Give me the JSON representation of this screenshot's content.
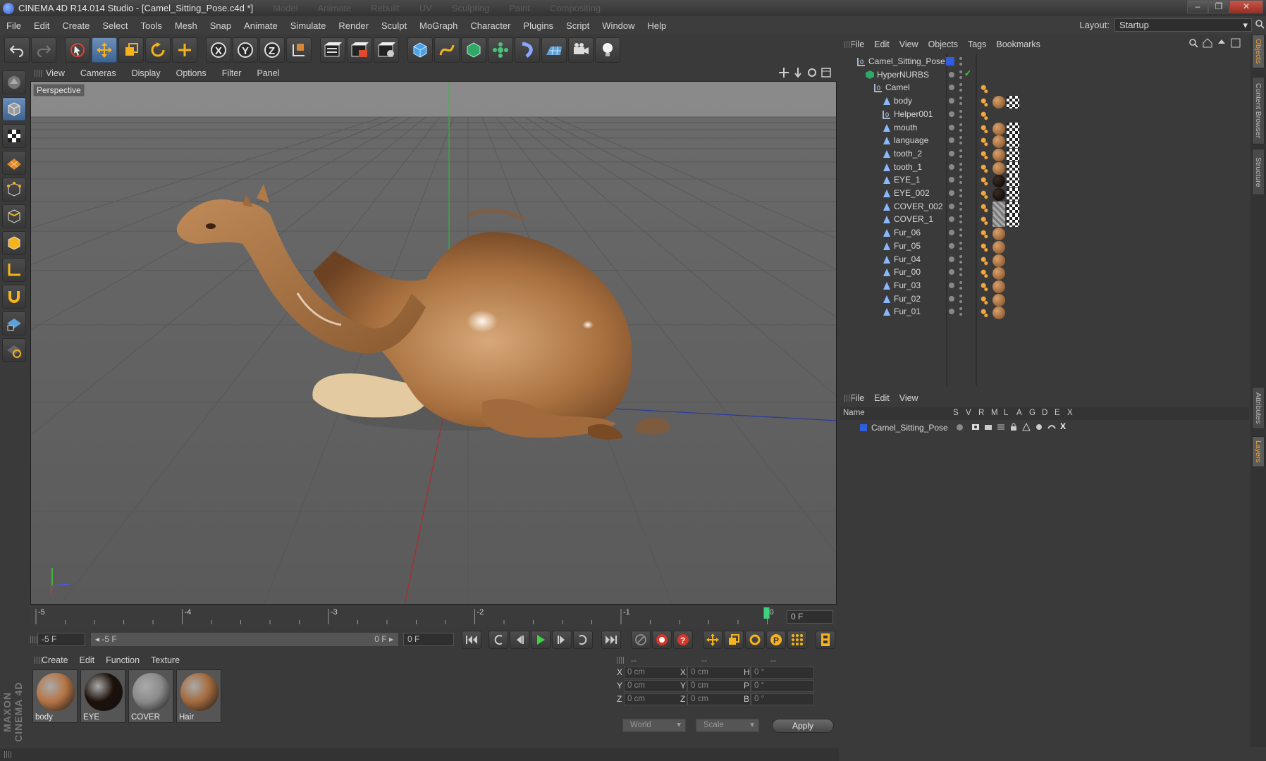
{
  "window": {
    "title": "CINEMA 4D R14.014 Studio - [Camel_Sitting_Pose.c4d *]",
    "ghost_tabs": [
      "Model",
      "Animate",
      "Rebuilt",
      "UV",
      "Sculpting",
      "Paint",
      "Compositing"
    ],
    "buttons": {
      "min": "–",
      "max": "❐",
      "close": "✕"
    }
  },
  "menu": {
    "items": [
      "File",
      "Edit",
      "Create",
      "Select",
      "Tools",
      "Mesh",
      "Snap",
      "Animate",
      "Simulate",
      "Render",
      "Sculpt",
      "MoGraph",
      "Character",
      "Plugins",
      "Script",
      "Window",
      "Help"
    ],
    "layout_label": "Layout:",
    "layout_value": "Startup"
  },
  "viewport": {
    "menu": [
      "View",
      "Cameras",
      "Display",
      "Options",
      "Filter",
      "Panel"
    ],
    "label": "Perspective"
  },
  "timeline": {
    "ticks": [
      "-5",
      "-4",
      "-3",
      "-2",
      "-1",
      "0"
    ],
    "current": "0 F"
  },
  "controls": {
    "start": "-5 F",
    "range_start": "-5 F",
    "range_end": "0 F",
    "end": "0 F"
  },
  "materials": {
    "menu": [
      "Create",
      "Edit",
      "Function",
      "Texture"
    ],
    "items": [
      {
        "name": "body",
        "color": "#b57445"
      },
      {
        "name": "EYE",
        "color": "#1c110a"
      },
      {
        "name": "COVER",
        "color": "#8a8a8a"
      },
      {
        "name": "Hair",
        "color": "#a36a3d"
      }
    ]
  },
  "coords": {
    "headers": [
      "--",
      "--",
      "--"
    ],
    "rows": [
      {
        "l1": "X",
        "v1": "0 cm",
        "l2": "X",
        "v2": "0 cm",
        "l3": "H",
        "v3": "0 °"
      },
      {
        "l1": "Y",
        "v1": "0 cm",
        "l2": "Y",
        "v2": "0 cm",
        "l3": "P",
        "v3": "0 °"
      },
      {
        "l1": "Z",
        "v1": "0 cm",
        "l2": "Z",
        "v2": "0 cm",
        "l3": "B",
        "v3": "0 °"
      }
    ],
    "world": "World",
    "scale": "Scale",
    "apply": "Apply"
  },
  "objects": {
    "menu": [
      "File",
      "Edit",
      "View",
      "Objects",
      "Tags",
      "Bookmarks"
    ],
    "items": [
      {
        "name": "Camel_Sitting_Pose",
        "tags": []
      },
      {
        "name": "HyperNURBS",
        "tags": []
      },
      {
        "name": "Camel",
        "tags": [
          "phong"
        ]
      },
      {
        "name": "body",
        "tags": [
          "phong",
          "matc",
          "uv"
        ]
      },
      {
        "name": "Helper001",
        "tags": [
          "phong"
        ]
      },
      {
        "name": "mouth",
        "tags": [
          "phong",
          "matc",
          "uv"
        ]
      },
      {
        "name": "language",
        "tags": [
          "phong",
          "matc",
          "uv"
        ]
      },
      {
        "name": "tooth_2",
        "tags": [
          "phong",
          "matc",
          "uv"
        ]
      },
      {
        "name": "tooth_1",
        "tags": [
          "phong",
          "matc",
          "uv"
        ]
      },
      {
        "name": "EYE_1",
        "tags": [
          "phong",
          "eye",
          "uv"
        ]
      },
      {
        "name": "EYE_002",
        "tags": [
          "phong",
          "eye",
          "uv"
        ]
      },
      {
        "name": "COVER_002",
        "tags": [
          "phong",
          "cover",
          "uv"
        ]
      },
      {
        "name": "COVER_1",
        "tags": [
          "phong",
          "cover",
          "uv"
        ]
      },
      {
        "name": "Fur_06",
        "tags": [
          "phong",
          "matc"
        ]
      },
      {
        "name": "Fur_05",
        "tags": [
          "phong",
          "matc"
        ]
      },
      {
        "name": "Fur_04",
        "tags": [
          "phong",
          "matc"
        ]
      },
      {
        "name": "Fur_00",
        "tags": [
          "phong",
          "matc"
        ]
      },
      {
        "name": "Fur_03",
        "tags": [
          "phong",
          "matc"
        ]
      },
      {
        "name": "Fur_02",
        "tags": [
          "phong",
          "matc"
        ]
      },
      {
        "name": "Fur_01",
        "tags": [
          "phong",
          "matc"
        ]
      }
    ]
  },
  "layers": {
    "menu": [
      "File",
      "Edit",
      "View"
    ],
    "columns": [
      "Name",
      "S",
      "V",
      "R",
      "M",
      "L",
      "A",
      "G",
      "D",
      "E",
      "X"
    ],
    "row": "Camel_Sitting_Pose",
    "layer_color": "#2f5fe0"
  },
  "sidetabs": [
    "Objects",
    "Content Browser",
    "Structure",
    "Attributes",
    "Layers"
  ],
  "colors": {
    "accent": "#f0a030",
    "selected": "#4f73a0"
  }
}
